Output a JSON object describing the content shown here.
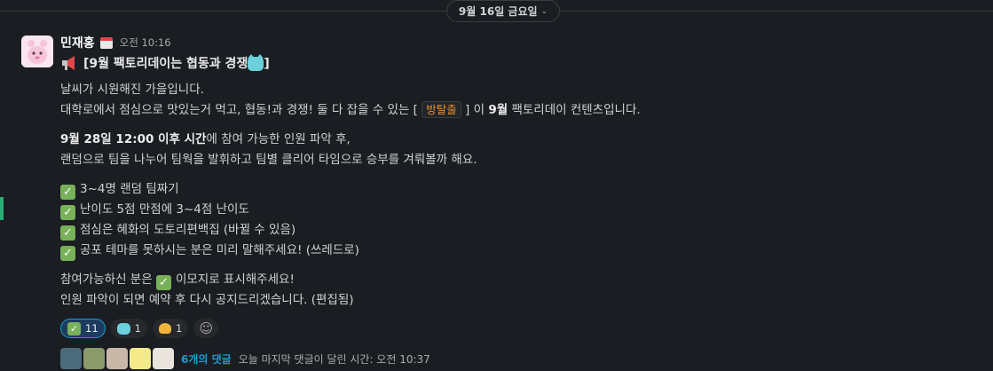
{
  "date_divider": {
    "label": "9월 16일 금요일"
  },
  "message": {
    "author": "민재홍",
    "timestamp": "오전 10:16",
    "title": "[9월 팩토리데이는 협동과 경쟁",
    "title_end": "]",
    "intro_line1": "날씨가 시원해진 가을입니다.",
    "intro_line2_a": "대학로에서 점심으로 맛있는거 먹고, 협동!과 경쟁! 둘 다 잡을 수 있는 [",
    "intro_tag": "방탈출",
    "intro_line2_b": "] 이",
    "intro_bold": "9월",
    "intro_line2_c": "팩토리데이 컨텐츠입니다.",
    "schedule_bold": "9월 28일 12:00 이후 시간",
    "schedule_rest": "에 참여 가능한 인원 파악 후,",
    "schedule_line2": "랜덤으로 팀을 나누어 팀웍을 발휘하고 팀별 클리어 타임으로 승부를 겨뤄볼까 해요.",
    "checklist": [
      "3~4명 랜덤 팀짜기",
      "난이도 5점 만점에 3~4점 난이도",
      "점심은 혜화의 도토리편백집 (바뀔 수 있음)",
      "공포 테마를 못하시는 분은 미리 말해주세요! (쓰레드로)"
    ],
    "closing_a": "참여가능하신 분은",
    "closing_b": "이모지로 표시해주세요!",
    "closing_line2": "인원 파악이 되면 예약 후 다시 공지드리겠습니다.",
    "edited_label": "(편집됨)"
  },
  "reactions": [
    {
      "icon": "check-emoji",
      "count": "11",
      "active": true
    },
    {
      "icon": "cat-emoji",
      "count": "1",
      "active": false
    },
    {
      "icon": "clap-emoji",
      "count": "1",
      "active": false
    }
  ],
  "thread": {
    "reply_count_label": "6개의 댓글",
    "last_reply_label": "오늘 마지막 댓글이 달린 시간: 오전 10:37"
  },
  "colors": {
    "background": "#1a1d21",
    "link": "#1d9bd1",
    "tag_text": "#e8912d",
    "check_green": "#78b159"
  }
}
